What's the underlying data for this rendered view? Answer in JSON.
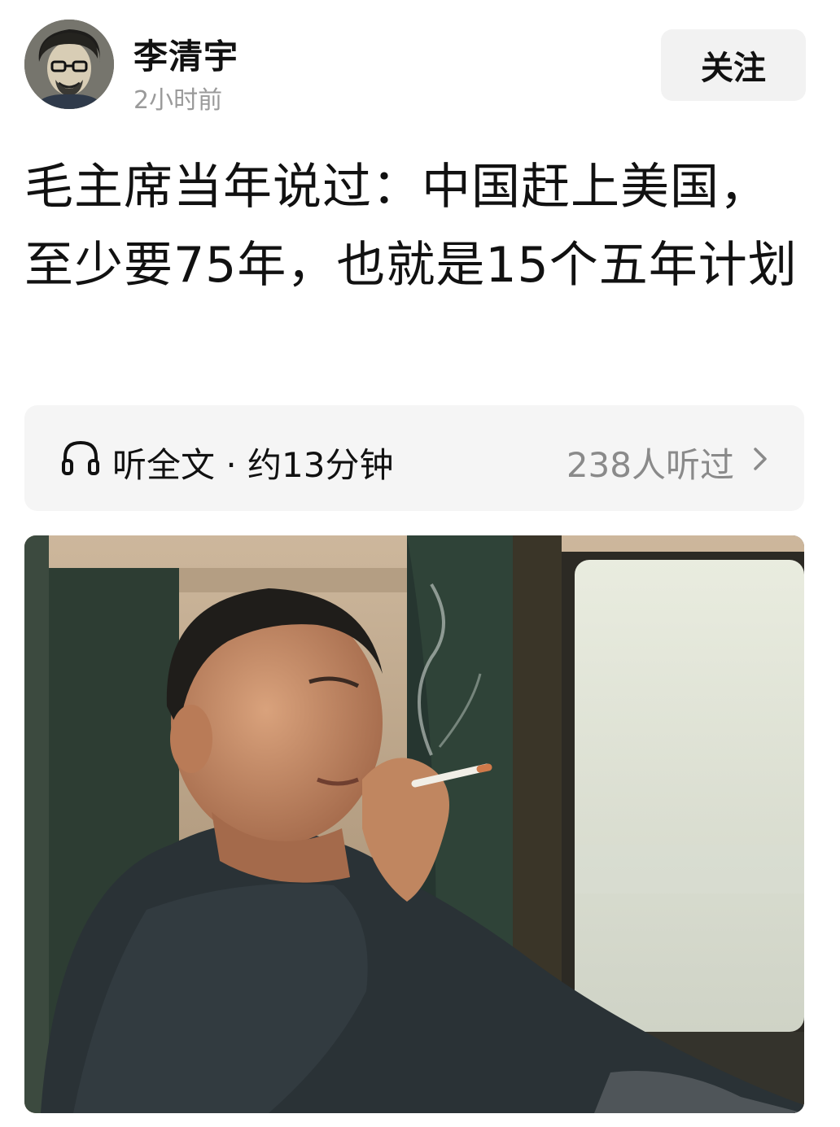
{
  "author": {
    "name": "李清宇",
    "time": "2小时前",
    "follow_label": "关注",
    "avatar_icon": "avatar-illustration"
  },
  "post": {
    "title": "毛主席当年说过：中国赶上美国，至少要75年，也就是15个五年计划"
  },
  "listen": {
    "label": "听全文 · 约13分钟",
    "count": "238人听过",
    "icon": "headphone-icon",
    "chevron": "chevron-right-icon"
  },
  "photo": {
    "subject": "historical-portrait-photo"
  },
  "colors": {
    "text": "#111111",
    "muted": "#9a9a9a",
    "button_bg": "#f2f2f2",
    "bar_bg": "#f5f5f5"
  }
}
